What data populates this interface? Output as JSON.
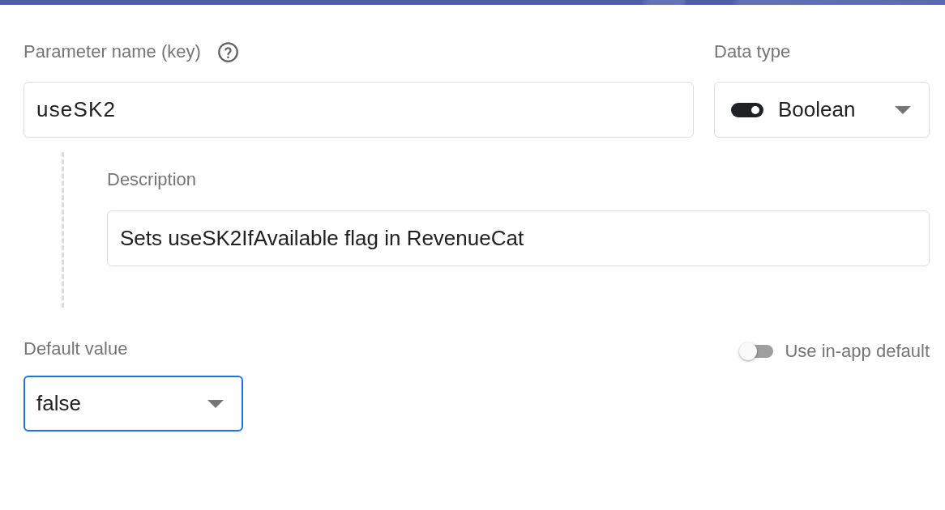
{
  "parameter_name": {
    "label": "Parameter name (key)",
    "value": "useSK2"
  },
  "data_type": {
    "label": "Data type",
    "value": "Boolean"
  },
  "description": {
    "label": "Description",
    "value": "Sets useSK2IfAvailable flag in RevenueCat"
  },
  "default_value": {
    "label": "Default value",
    "value": "false",
    "focused": true
  },
  "use_in_app_default": {
    "label": "Use in-app default",
    "on": false
  }
}
